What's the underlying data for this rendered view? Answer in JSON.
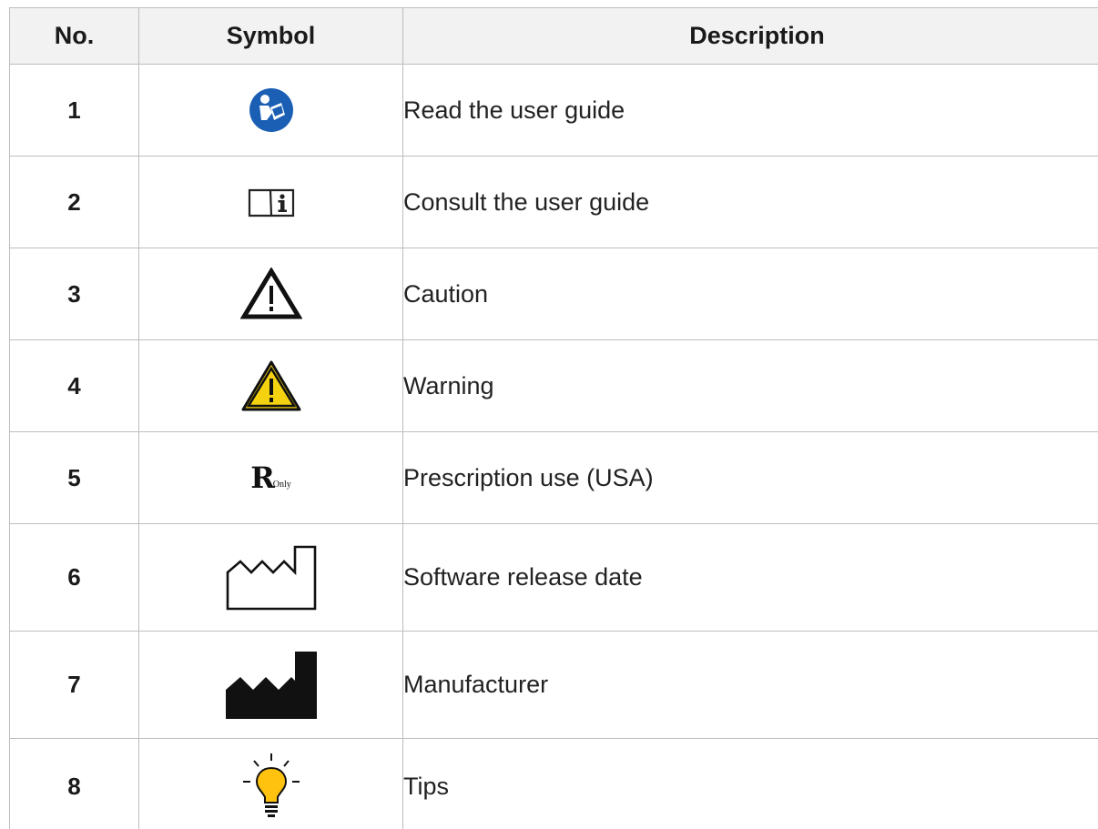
{
  "table": {
    "headers": {
      "no": "No.",
      "symbol": "Symbol",
      "description": "Description"
    },
    "rows": [
      {
        "no": "1",
        "symbol_icon": "read-user-guide-icon",
        "description": "Read the user guide"
      },
      {
        "no": "2",
        "symbol_icon": "consult-user-guide-icon",
        "description": "Consult the user guide"
      },
      {
        "no": "3",
        "symbol_icon": "caution-triangle-icon",
        "description": "Caution"
      },
      {
        "no": "4",
        "symbol_icon": "warning-triangle-icon",
        "description": "Warning"
      },
      {
        "no": "5",
        "symbol_icon": "rx-only-icon",
        "symbol_text": {
          "rx": "R",
          "only": "Only"
        },
        "description": "Prescription use (USA)"
      },
      {
        "no": "6",
        "symbol_icon": "release-date-factory-outline-icon",
        "description": "Software release date"
      },
      {
        "no": "7",
        "symbol_icon": "manufacturer-factory-icon",
        "description": "Manufacturer"
      },
      {
        "no": "8",
        "symbol_icon": "lightbulb-icon",
        "description": "Tips"
      }
    ]
  },
  "colors": {
    "header_background": "#f2f2f2",
    "border": "#bdbdbd",
    "read_guide_blue": "#1a5fb4",
    "warning_yellow": "#f5d20f",
    "tips_bulb_yellow": "#ffc20e"
  }
}
